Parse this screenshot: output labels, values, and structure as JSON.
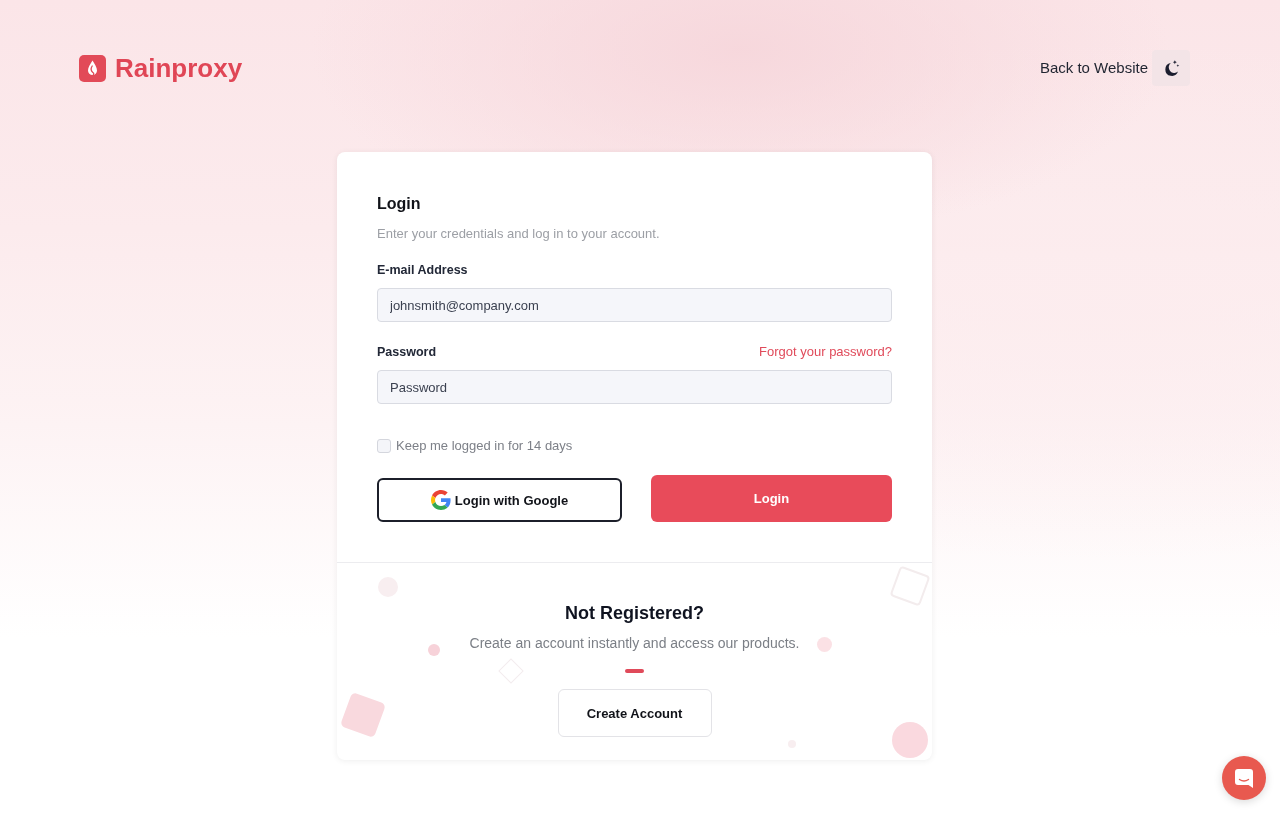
{
  "header": {
    "brand": "Rainproxy",
    "back_link": "Back to Website"
  },
  "login": {
    "title": "Login",
    "subtitle": "Enter your credentials and log in to your account.",
    "fields": [
      {
        "label": "E-mail Address",
        "placeholder": "johnsmith@company.com"
      },
      {
        "label": "Password",
        "placeholder": "Password",
        "link": "Forgot your password?"
      }
    ],
    "remember": {
      "label": "Keep me logged in for 14 days",
      "checked": false
    },
    "buttons": [
      {
        "kind": "google",
        "label": "Login with Google"
      },
      {
        "kind": "primary",
        "label": "Login"
      }
    ]
  },
  "register": {
    "title": "Not Registered?",
    "text": "Create an account instantly and access our products.",
    "button": "Create Account"
  }
}
